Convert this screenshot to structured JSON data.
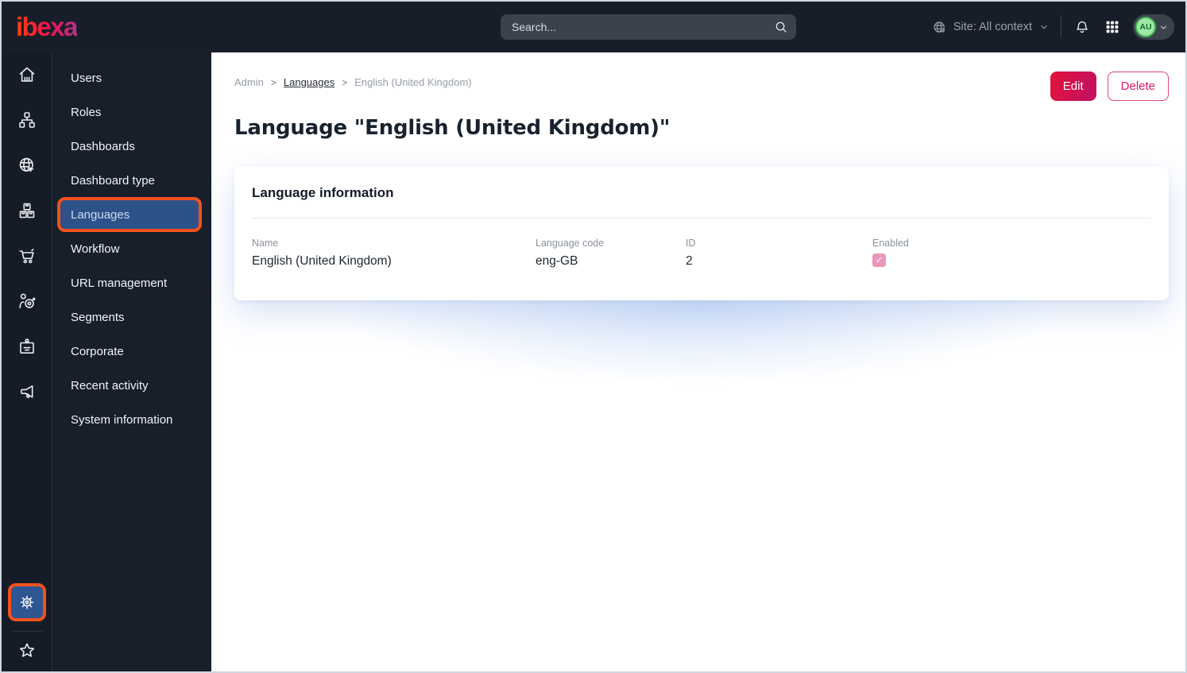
{
  "topbar": {
    "logo_text": "ibexa",
    "search": {
      "placeholder": "Search..."
    },
    "site_context_label": "Site: All context",
    "avatar_initials": "AU"
  },
  "icon_rail": {
    "top_icons": [
      "home",
      "content-structure",
      "site",
      "products",
      "commerce",
      "personalization",
      "corporate-badge",
      "marketing-megaphone"
    ],
    "bottom_icons": [
      "settings-gear",
      "bookmarks-star"
    ],
    "selected": "settings-gear"
  },
  "sidebar": {
    "selected": "Languages",
    "items": [
      {
        "label": "Users"
      },
      {
        "label": "Roles"
      },
      {
        "label": "Dashboards"
      },
      {
        "label": "Dashboard type"
      },
      {
        "label": "Languages"
      },
      {
        "label": "Workflow"
      },
      {
        "label": "URL management"
      },
      {
        "label": "Segments"
      },
      {
        "label": "Corporate"
      },
      {
        "label": "Recent activity"
      },
      {
        "label": "System information"
      }
    ]
  },
  "breadcrumb": {
    "separator": ">",
    "items": [
      {
        "label": "Admin"
      },
      {
        "label": "Languages"
      },
      {
        "label": "English (United Kingdom)"
      }
    ]
  },
  "actions": {
    "edit_label": "Edit",
    "delete_label": "Delete"
  },
  "page": {
    "title": "Language \"English (United Kingdom)\""
  },
  "card": {
    "heading": "Language information",
    "fields": [
      {
        "label": "Name",
        "value": "English (United Kingdom)"
      },
      {
        "label": "Language code",
        "value": "eng-GB"
      },
      {
        "label": "ID",
        "value": "2"
      },
      {
        "label": "Enabled",
        "checked": true,
        "check_glyph": "✓"
      }
    ]
  },
  "colors": {
    "topbar_bg": "#171e29",
    "rail_bg": "#151c27",
    "menu_bg": "#171f2b",
    "selected_blue": "#2d5289",
    "annotation_orange": "#f4511c",
    "accent_primary": "#db0f53",
    "enabled_checkbox_pink": "#e998bf",
    "avatar_green": "#43b64d"
  }
}
